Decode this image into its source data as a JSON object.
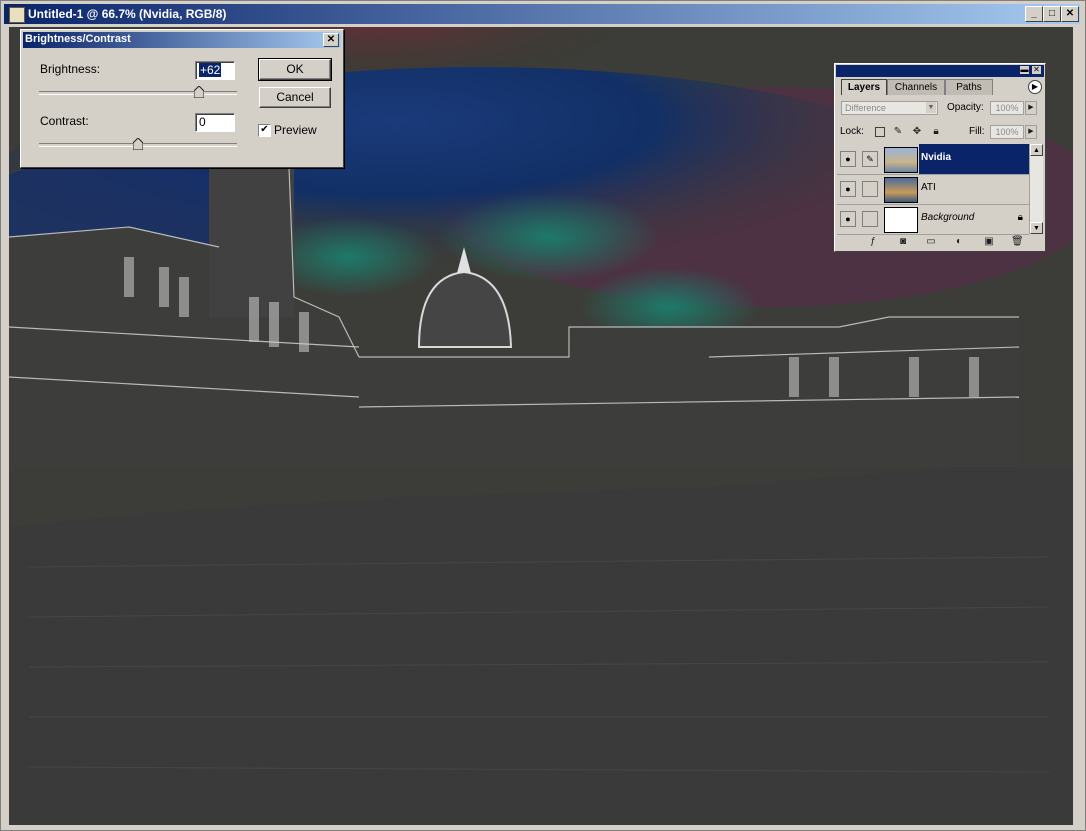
{
  "window": {
    "title": "Untitled-1 @ 66.7% (Nvidia, RGB/8)",
    "controls": [
      "minimize",
      "maximize",
      "close"
    ]
  },
  "dialog": {
    "title": "Brightness/Contrast",
    "brightness_label": "Brightness:",
    "brightness_value": "+62",
    "brightness_level": 62,
    "contrast_label": "Contrast:",
    "contrast_value": "0",
    "contrast_level": 0,
    "ok_label": "OK",
    "cancel_label": "Cancel",
    "preview_label": "Preview",
    "preview_checked": true
  },
  "layers_panel": {
    "tabs": [
      "Layers",
      "Channels",
      "Paths"
    ],
    "active_tab": "Layers",
    "blend_mode": "Difference",
    "opacity_label": "Opacity:",
    "opacity_value": "100%",
    "lock_label": "Lock:",
    "fill_label": "Fill:",
    "fill_value": "100%",
    "layers": [
      {
        "name": "Nvidia",
        "visible": true,
        "selected": true,
        "italic": false,
        "locked": false
      },
      {
        "name": "ATI",
        "visible": true,
        "selected": false,
        "italic": false,
        "locked": false
      },
      {
        "name": "Background",
        "visible": true,
        "selected": false,
        "italic": true,
        "locked": true
      }
    ],
    "bottom_icons": [
      "layer-style-icon",
      "mask-icon",
      "group-icon",
      "adjustment-icon",
      "new-layer-icon",
      "trash-icon"
    ]
  },
  "colors": {
    "titlebar": "#0a246a",
    "selection": "#0a246a"
  }
}
